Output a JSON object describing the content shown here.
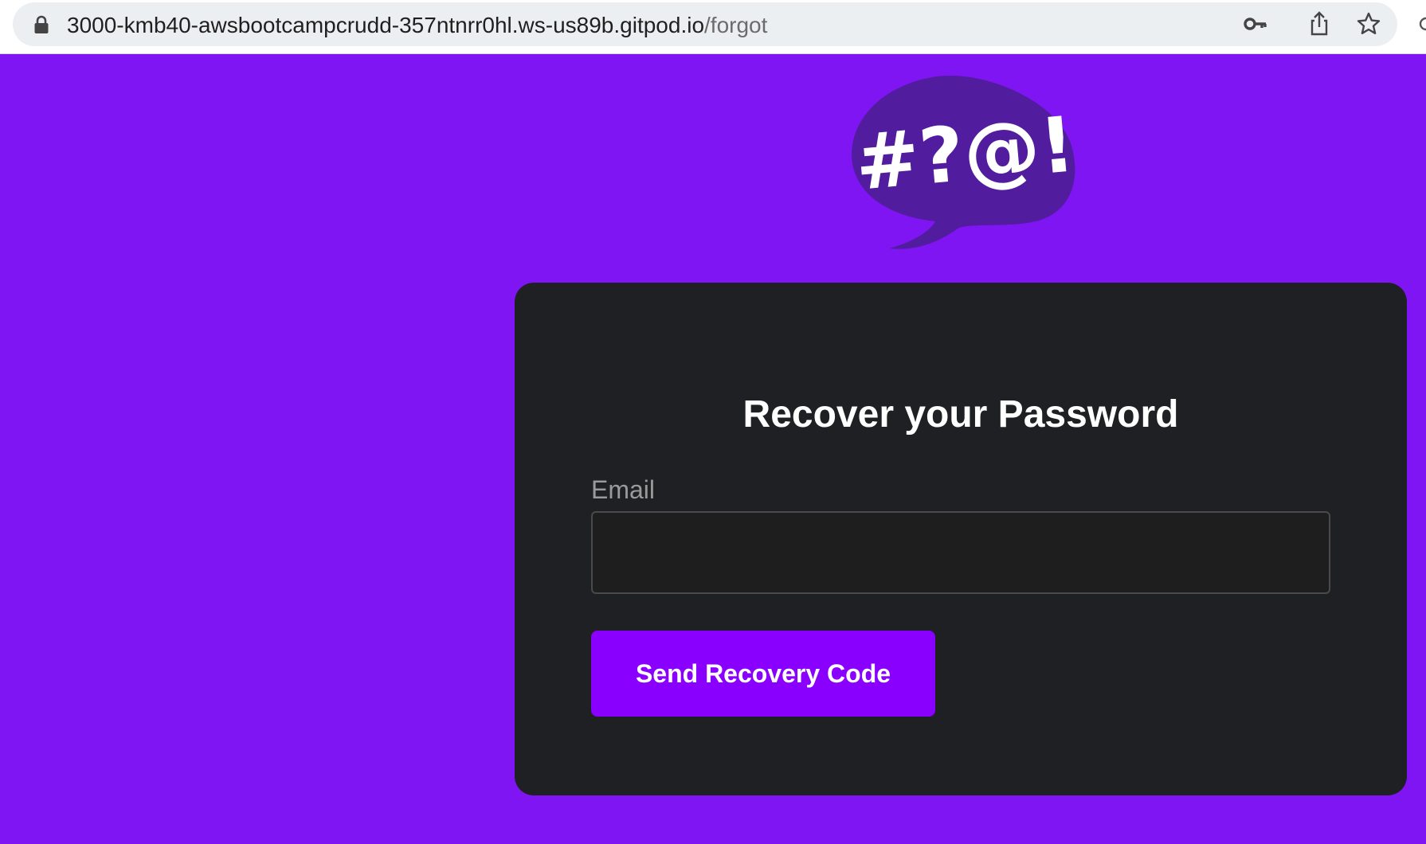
{
  "browser": {
    "url_host": "3000-kmb40-awsbootcampcrudd-357ntnrr0hl.ws-us89b.gitpod.io",
    "url_path": "/forgot",
    "icons": [
      "lock-icon",
      "key-icon",
      "share-icon",
      "star-icon"
    ]
  },
  "logo": {
    "text": "#?@!",
    "bubble_color": "#521c9e"
  },
  "recover_form": {
    "title": "Recover your Password",
    "email_label": "Email",
    "email_value": "",
    "submit_label": "Send Recovery Code"
  },
  "colors": {
    "page_background": "#7f15f2",
    "card_background": "#1f2023",
    "button_background": "#8a00ff"
  }
}
